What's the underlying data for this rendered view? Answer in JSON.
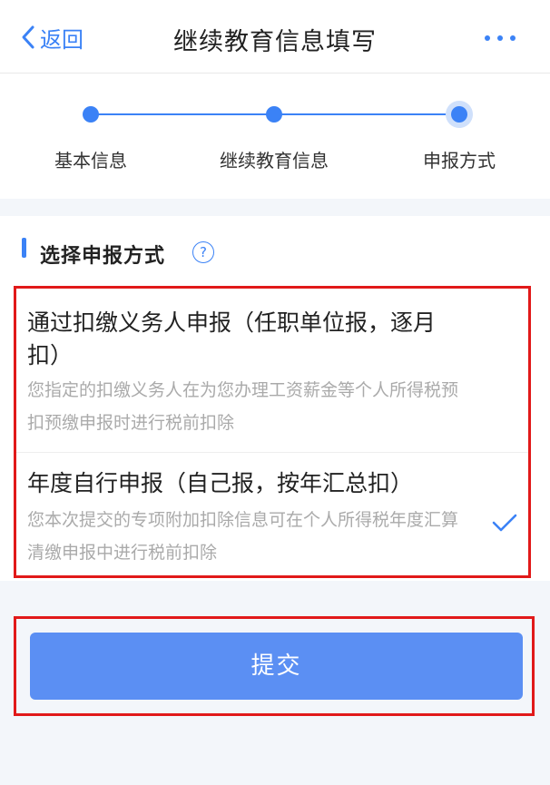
{
  "header": {
    "back_label": "返回",
    "title": "继续教育信息填写",
    "more_icon": "more-dots-icon"
  },
  "steps": [
    {
      "label": "基本信息",
      "state": "done"
    },
    {
      "label": "继续教育信息",
      "state": "done"
    },
    {
      "label": "申报方式",
      "state": "current"
    }
  ],
  "section": {
    "title": "选择申报方式",
    "help_glyph": "?"
  },
  "options": [
    {
      "title": "通过扣缴义务人申报（任职单位报，逐月扣）",
      "description": "您指定的扣缴义务人在为您办理工资薪金等个人所得税预扣预缴申报时进行税前扣除",
      "selected": false
    },
    {
      "title": "年度自行申报（自己报，按年汇总扣）",
      "description": "您本次提交的专项附加扣除信息可在个人所得税年度汇算清缴申报中进行税前扣除",
      "selected": true
    }
  ],
  "submit": {
    "label": "提交"
  },
  "colors": {
    "accent": "#3b82f6",
    "button": "#5b8ff3",
    "highlight_border": "#e11919"
  }
}
